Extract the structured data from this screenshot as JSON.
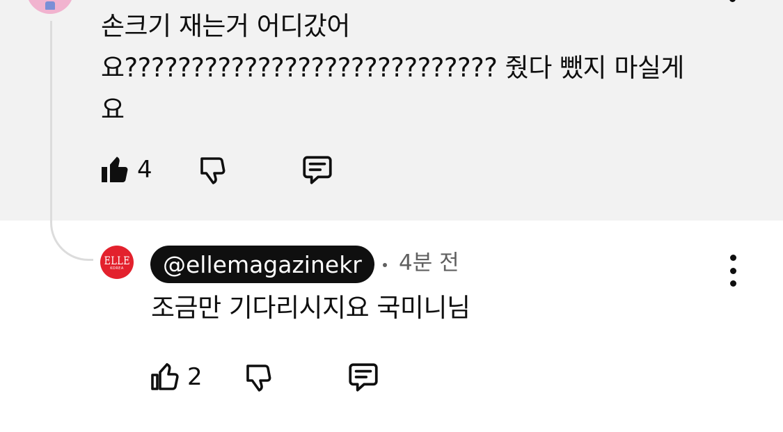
{
  "parent_comment": {
    "text": "손크기 재는거 어디갔어\n요???????????????????????????? 줬다 뺐지 마실게\n요",
    "like_count": "4",
    "icons": {
      "like": "thumbs-up-filled-icon",
      "dislike": "thumbs-down-icon",
      "reply": "comment-icon"
    }
  },
  "reply_comment": {
    "author": "@ellemagazinekr",
    "timestamp": "4분 전",
    "avatar": {
      "logo_text": "ELLE",
      "logo_subtext": "KOREA",
      "background": "#e3212d"
    },
    "text": "조금만 기다리시지요 국미니님",
    "like_count": "2",
    "icons": {
      "like": "thumbs-up-outline-icon",
      "dislike": "thumbs-down-icon",
      "reply": "comment-icon",
      "menu": "more-vertical-icon"
    }
  },
  "colors": {
    "highlight_background": "#f2f2f2",
    "author_chip_background": "#0f0f0f",
    "secondary_text": "#606060"
  }
}
